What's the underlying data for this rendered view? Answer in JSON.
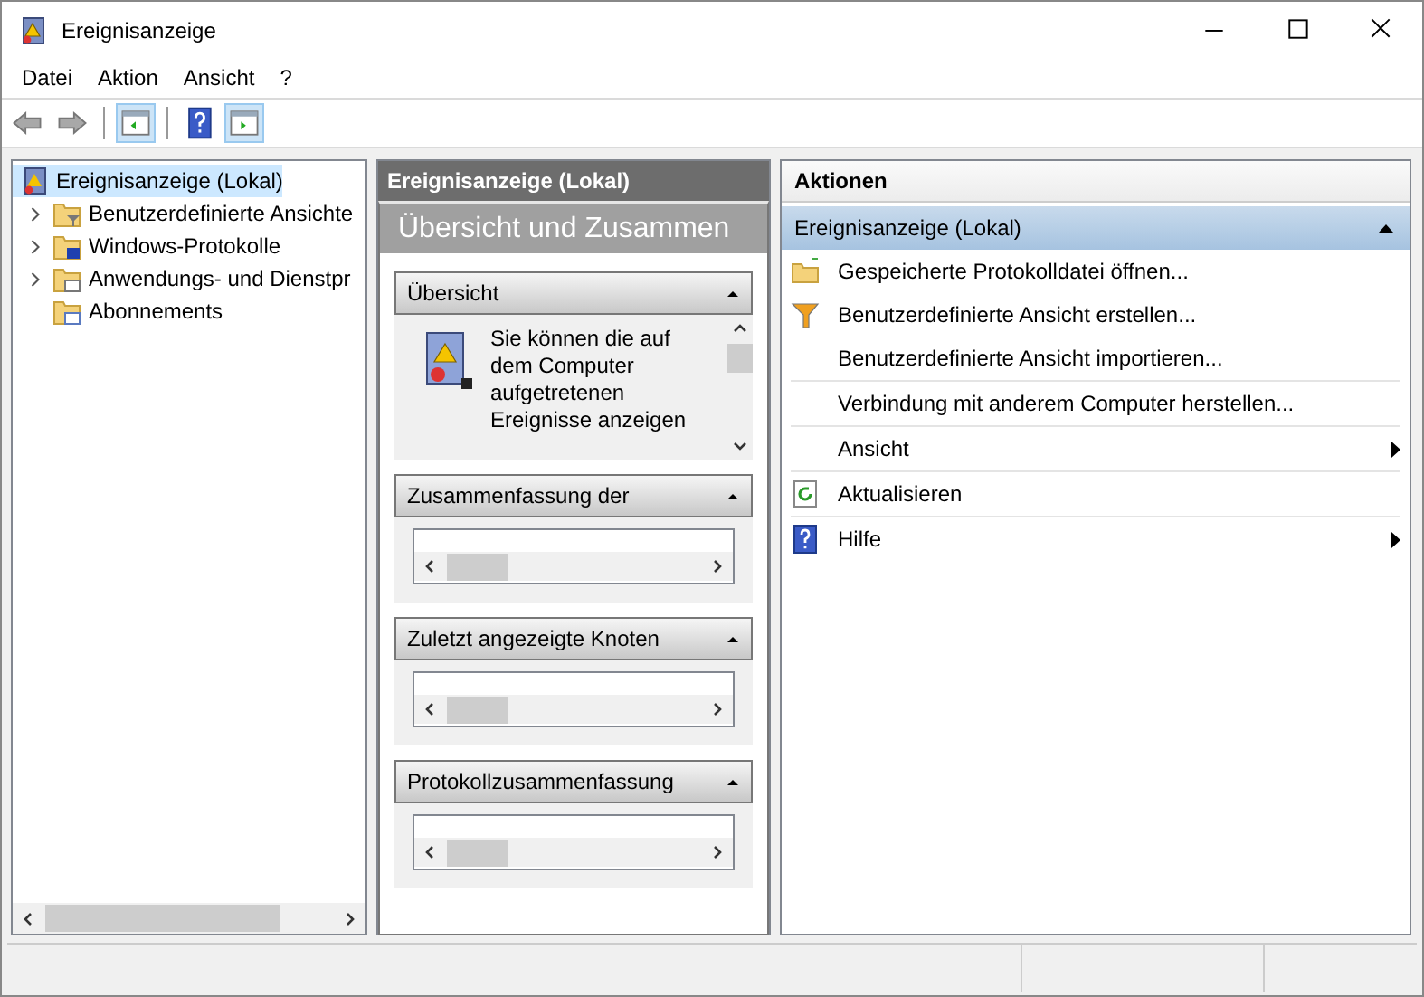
{
  "window": {
    "title": "Ereignisanzeige"
  },
  "menu": [
    {
      "label": "Datei"
    },
    {
      "label": "Aktion"
    },
    {
      "label": "Ansicht"
    },
    {
      "label": "?"
    }
  ],
  "toolbar": [
    {
      "kind": "back",
      "pressed": false
    },
    {
      "kind": "forward",
      "pressed": false
    },
    {
      "kind": "tree",
      "pressed": true
    },
    {
      "kind": "help",
      "pressed": false
    },
    {
      "kind": "actions",
      "pressed": true
    }
  ],
  "tree": {
    "label": "Ereignisanzeige (Lokal)",
    "selected": true,
    "children": [
      {
        "label": "Benutzerdefinierte Ansichte",
        "kind": "filter-folder",
        "expanded": false,
        "selected": false
      },
      {
        "label": "Windows-Protokolle",
        "kind": "log-folder",
        "expanded": false,
        "selected": false
      },
      {
        "label": "Anwendungs- und Dienstpr",
        "kind": "app-folder",
        "expanded": false,
        "selected": false
      },
      {
        "label": "Abonnements",
        "kind": "subscription-folder",
        "selected": false
      }
    ]
  },
  "center": {
    "header": "Ereignisanzeige (Lokal)",
    "title": "Übersicht und Zusammen",
    "sections": [
      {
        "kind": "text",
        "title": "Übersicht",
        "expanded": true,
        "text": "Sie können die auf dem Computer aufgetretenen Ereignisse anzeigen"
      },
      {
        "kind": "table",
        "title": "Zusammenfassung der",
        "expanded": true
      },
      {
        "kind": "table",
        "title": "Zuletzt angezeigte Knoten",
        "expanded": true
      },
      {
        "kind": "table",
        "title": "Protokollzusammenfassung",
        "expanded": true
      }
    ]
  },
  "actions": {
    "title": "Aktionen",
    "group": {
      "label": "Ereignisanzeige (Lokal)",
      "expanded": true
    },
    "items": [
      {
        "label": "Gespeicherte Protokolldatei öffnen...",
        "kind": "folder",
        "submenu": false
      },
      {
        "label": "Benutzerdefinierte Ansicht erstellen...",
        "kind": "filter",
        "submenu": false
      },
      {
        "label": "Benutzerdefinierte Ansicht importieren...",
        "submenu": false
      },
      {
        "label": "Verbindung mit anderem Computer herstellen...",
        "submenu": false
      },
      {
        "label": "Ansicht",
        "submenu": true
      },
      {
        "label": "Aktualisieren",
        "kind": "refresh",
        "submenu": false
      },
      {
        "label": "Hilfe",
        "kind": "help",
        "submenu": true
      }
    ]
  }
}
